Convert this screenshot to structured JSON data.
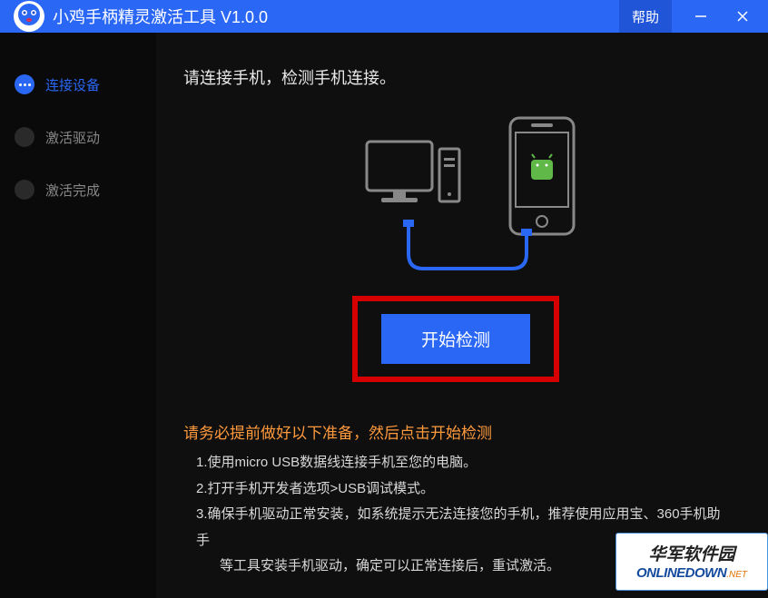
{
  "titlebar": {
    "app_title": "小鸡手柄精灵激活工具 V1.0.0",
    "help_label": "帮助"
  },
  "sidebar": {
    "items": [
      {
        "label": "连接设备",
        "active": true
      },
      {
        "label": "激活驱动",
        "active": false
      },
      {
        "label": "激活完成",
        "active": false
      }
    ]
  },
  "main": {
    "instruction": "请连接手机，检测手机连接。",
    "detect_button": "开始检测",
    "prep_title": "请务必提前做好以下准备，然后点击开始检测",
    "prep_steps": [
      "1.使用micro USB数据线连接手机至您的电脑。",
      "2.打开手机开发者选项>USB调试模式。",
      "3.确保手机驱动正常安装，如系统提示无法连接您的手机，推荐使用应用宝、360手机助手",
      "等工具安装手机驱动，确定可以正常连接后，重试激活。"
    ]
  },
  "watermark": {
    "cn": "华军软件园",
    "en": "ONLINEDOWN",
    "net": ".NET"
  }
}
